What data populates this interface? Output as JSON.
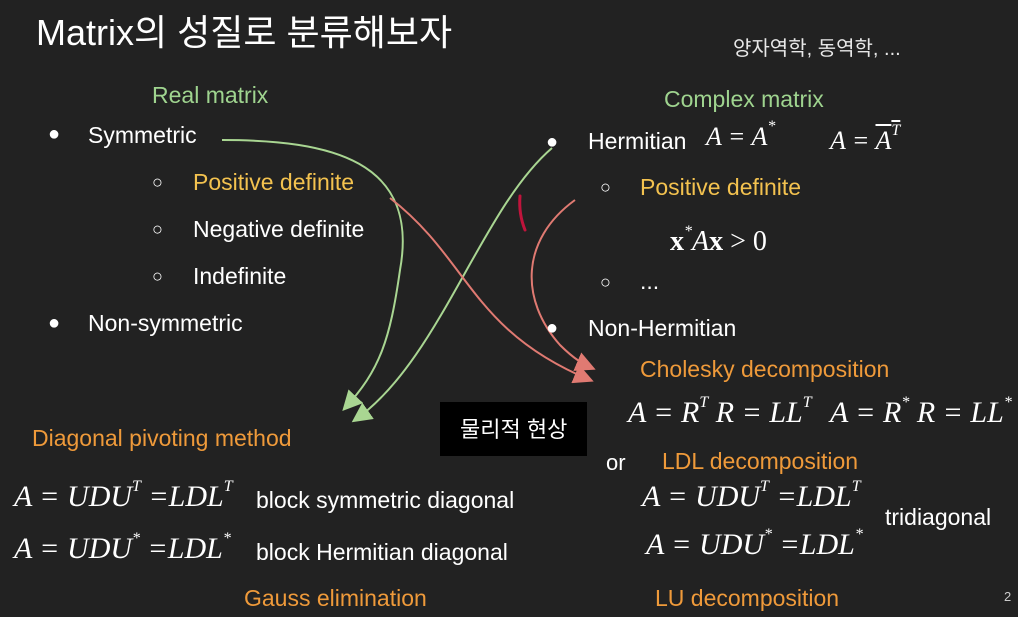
{
  "slide": {
    "title": "Matrix의 성질로 분류해보자",
    "note": "양자역학, 동역학, ...",
    "page_number": "2"
  },
  "real": {
    "heading": "Real matrix",
    "symmetric": "Symmetric",
    "positive_definite": "Positive definite",
    "negative_definite": "Negative definite",
    "indefinite": "Indefinite",
    "non_symmetric": "Non-symmetric"
  },
  "complex": {
    "heading": "Complex matrix",
    "hermitian": "Hermitian",
    "positive_definite": "Positive definite",
    "ellipsis": "...",
    "non_hermitian": "Non-Hermitian"
  },
  "methods": {
    "diagonal_pivoting": "Diagonal pivoting method",
    "block_symmetric": "block symmetric diagonal",
    "block_hermitian": "block Hermitian diagonal",
    "gauss": "Gauss elimination",
    "cholesky": "Cholesky decomposition",
    "or": "or",
    "ldl": "LDL decomposition",
    "tridiagonal": "tridiagonal",
    "lu": "LU decomposition"
  },
  "label_box": "물리적 현상",
  "colors": {
    "background": "#222222",
    "green": "#9fd48f",
    "yellow": "#f3c24f",
    "orange": "#ef9a3a",
    "red_arrow": "#e07a72",
    "green_arrow": "#a9d692",
    "mark": "#c0143c"
  }
}
